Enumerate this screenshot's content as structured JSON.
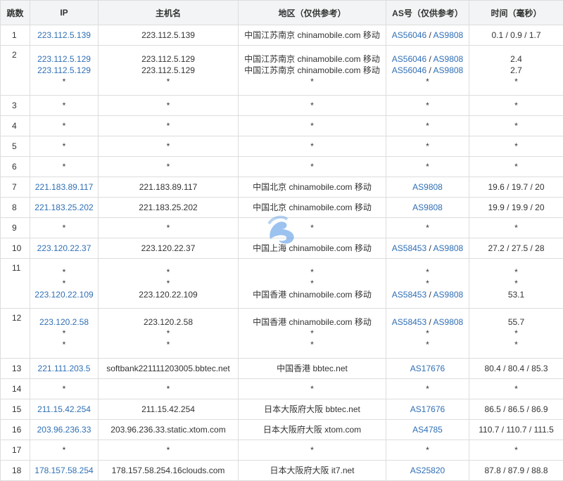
{
  "headers": [
    "跳数",
    "IP",
    "主机名",
    "地区（仅供参考）",
    "AS号（仅供参考）",
    "时间（毫秒）"
  ],
  "rows": [
    {
      "hop": "1",
      "ip": [
        "223.112.5.139"
      ],
      "host": [
        "223.112.5.139"
      ],
      "loc": [
        "中国江苏南京 chinamobile.com 移动"
      ],
      "as": [
        [
          "AS56046",
          "AS9808"
        ]
      ],
      "time": [
        "0.1 / 0.9 / 1.7"
      ]
    },
    {
      "hop": "2",
      "ip": [
        "223.112.5.129",
        "223.112.5.129",
        "*"
      ],
      "host": [
        "223.112.5.129",
        "223.112.5.129",
        "*"
      ],
      "loc": [
        "中国江苏南京 chinamobile.com 移动",
        "中国江苏南京 chinamobile.com 移动",
        "*"
      ],
      "as": [
        [
          "AS56046",
          "AS9808"
        ],
        [
          "AS56046",
          "AS9808"
        ],
        [
          "*"
        ]
      ],
      "time": [
        "2.4",
        "2.7",
        "*"
      ]
    },
    {
      "hop": "3",
      "ip": [
        "*"
      ],
      "host": [
        "*"
      ],
      "loc": [
        "*"
      ],
      "as": [
        [
          "*"
        ]
      ],
      "time": [
        "*"
      ]
    },
    {
      "hop": "4",
      "ip": [
        "*"
      ],
      "host": [
        "*"
      ],
      "loc": [
        "*"
      ],
      "as": [
        [
          "*"
        ]
      ],
      "time": [
        "*"
      ]
    },
    {
      "hop": "5",
      "ip": [
        "*"
      ],
      "host": [
        "*"
      ],
      "loc": [
        "*"
      ],
      "as": [
        [
          "*"
        ]
      ],
      "time": [
        "*"
      ]
    },
    {
      "hop": "6",
      "ip": [
        "*"
      ],
      "host": [
        "*"
      ],
      "loc": [
        "*"
      ],
      "as": [
        [
          "*"
        ]
      ],
      "time": [
        "*"
      ]
    },
    {
      "hop": "7",
      "ip": [
        "221.183.89.117"
      ],
      "host": [
        "221.183.89.117"
      ],
      "loc": [
        "中国北京 chinamobile.com 移动"
      ],
      "as": [
        [
          "AS9808"
        ]
      ],
      "time": [
        "19.6 / 19.7 / 20"
      ]
    },
    {
      "hop": "8",
      "ip": [
        "221.183.25.202"
      ],
      "host": [
        "221.183.25.202"
      ],
      "loc": [
        "中国北京 chinamobile.com 移动"
      ],
      "as": [
        [
          "AS9808"
        ]
      ],
      "time": [
        "19.9 / 19.9 / 20"
      ]
    },
    {
      "hop": "9",
      "ip": [
        "*"
      ],
      "host": [
        "*"
      ],
      "loc": [
        "*"
      ],
      "as": [
        [
          "*"
        ]
      ],
      "time": [
        "*"
      ]
    },
    {
      "hop": "10",
      "ip": [
        "223.120.22.37"
      ],
      "host": [
        "223.120.22.37"
      ],
      "loc": [
        "中国上海 chinamobile.com 移动"
      ],
      "as": [
        [
          "AS58453",
          "AS9808"
        ]
      ],
      "time": [
        "27.2 / 27.5 / 28"
      ]
    },
    {
      "hop": "11",
      "ip": [
        "*",
        "*",
        "223.120.22.109"
      ],
      "host": [
        "*",
        "*",
        "223.120.22.109"
      ],
      "loc": [
        "*",
        "*",
        "中国香港 chinamobile.com 移动"
      ],
      "as": [
        [
          "*"
        ],
        [
          "*"
        ],
        [
          "AS58453",
          "AS9808"
        ]
      ],
      "time": [
        "*",
        "*",
        "53.1"
      ]
    },
    {
      "hop": "12",
      "ip": [
        "223.120.2.58",
        "*",
        "*"
      ],
      "host": [
        "223.120.2.58",
        "*",
        "*"
      ],
      "loc": [
        "中国香港 chinamobile.com 移动",
        "*",
        "*"
      ],
      "as": [
        [
          "AS58453",
          "AS9808"
        ],
        [
          "*"
        ],
        [
          "*"
        ]
      ],
      "time": [
        "55.7",
        "*",
        "*"
      ]
    },
    {
      "hop": "13",
      "ip": [
        "221.111.203.5"
      ],
      "host": [
        "softbank221111203005.bbtec.net"
      ],
      "loc": [
        "中国香港 bbtec.net"
      ],
      "as": [
        [
          "AS17676"
        ]
      ],
      "time": [
        "80.4 / 80.4 / 85.3"
      ]
    },
    {
      "hop": "14",
      "ip": [
        "*"
      ],
      "host": [
        "*"
      ],
      "loc": [
        "*"
      ],
      "as": [
        [
          "*"
        ]
      ],
      "time": [
        "*"
      ]
    },
    {
      "hop": "15",
      "ip": [
        "211.15.42.254"
      ],
      "host": [
        "211.15.42.254"
      ],
      "loc": [
        "日本大阪府大阪 bbtec.net"
      ],
      "as": [
        [
          "AS17676"
        ]
      ],
      "time": [
        "86.5 / 86.5 / 86.9"
      ]
    },
    {
      "hop": "16",
      "ip": [
        "203.96.236.33"
      ],
      "host": [
        "203.96.236.33.static.xtom.com"
      ],
      "loc": [
        "日本大阪府大阪 xtom.com"
      ],
      "as": [
        [
          "AS4785"
        ]
      ],
      "time": [
        "110.7 / 110.7 / 111.5"
      ]
    },
    {
      "hop": "17",
      "ip": [
        "*"
      ],
      "host": [
        "*"
      ],
      "loc": [
        "*"
      ],
      "as": [
        [
          "*"
        ]
      ],
      "time": [
        "*"
      ]
    },
    {
      "hop": "18",
      "ip": [
        "178.157.58.254"
      ],
      "host": [
        "178.157.58.254.16clouds.com"
      ],
      "loc": [
        "日本大阪府大阪 it7.net"
      ],
      "as": [
        [
          "AS25820"
        ]
      ],
      "time": [
        "87.8 / 87.9 / 88.8"
      ]
    }
  ],
  "colors": {
    "link": "#2f6fb5",
    "header_bg": "#f2f4f5",
    "border": "#dddddd",
    "watermark": "#4a90e2"
  },
  "watermark_icon": "logo-icon"
}
